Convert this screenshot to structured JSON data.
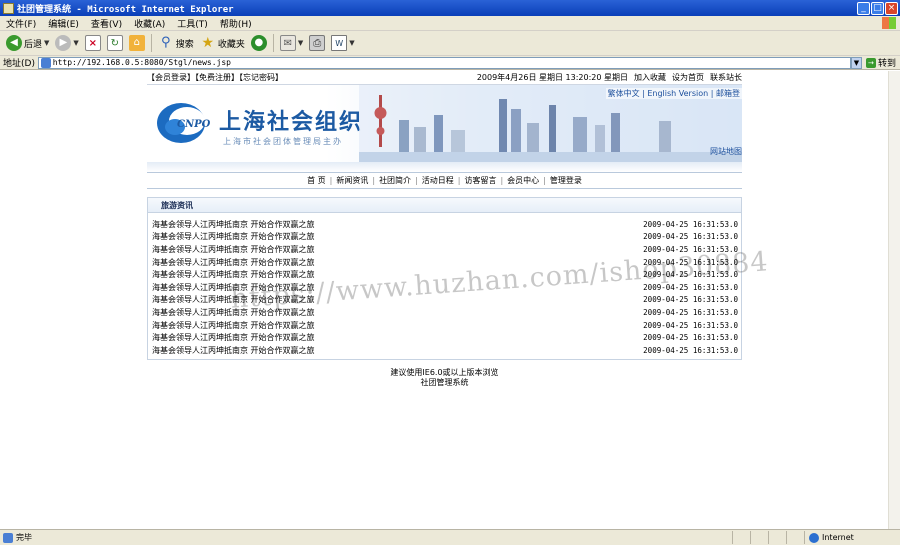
{
  "window": {
    "title": "社团管理系统 - Microsoft Internet Explorer",
    "minimize": "_",
    "maximize": "□",
    "close": "×"
  },
  "menubar": {
    "items": [
      "文件(F)",
      "编辑(E)",
      "查看(V)",
      "收藏(A)",
      "工具(T)",
      "帮助(H)"
    ]
  },
  "toolbar": {
    "back": "后退",
    "search": "搜索",
    "favorites": "收藏夹"
  },
  "address": {
    "label": "地址(D)",
    "url": "http://192.168.0.5:8080/Stgl/news.jsp",
    "go": "转到"
  },
  "page": {
    "top_links": "【会员登录】【免费注册】【忘记密码】",
    "date_text": "2009年4月26日 星期日 13:20:20 星期日",
    "top_right": [
      "加入收藏",
      "设为首页",
      "联系站长"
    ],
    "site_name": "上海社会组织",
    "site_sub": "上海市社会团体管理局主办",
    "logo_text": "CNPO",
    "lang_links": "繁体中文 | English Version | 邮箱登",
    "sitemap": "网站地图",
    "nav": [
      "首 页",
      "新闻资讯",
      "社团简介",
      "活动日程",
      "访客留言",
      "会员中心",
      "管理登录"
    ],
    "section_title": "旅游资讯",
    "news": [
      {
        "title": "海基会领导人江丙坤抵南京 开始合作双赢之旅",
        "date": "2009-04-25 16:31:53.0"
      },
      {
        "title": "海基会领导人江丙坤抵南京 开始合作双赢之旅",
        "date": "2009-04-25 16:31:53.0"
      },
      {
        "title": "海基会领导人江丙坤抵南京 开始合作双赢之旅",
        "date": "2009-04-25 16:31:53.0"
      },
      {
        "title": "海基会领导人江丙坤抵南京 开始合作双赢之旅",
        "date": "2009-04-25 16:31:53.0"
      },
      {
        "title": "海基会领导人江丙坤抵南京 开始合作双赢之旅",
        "date": "2009-04-25 16:31:53.0"
      },
      {
        "title": "海基会领导人江丙坤抵南京 开始合作双赢之旅",
        "date": "2009-04-25 16:31:53.0"
      },
      {
        "title": "海基会领导人江丙坤抵南京 开始合作双赢之旅",
        "date": "2009-04-25 16:31:53.0"
      },
      {
        "title": "海基会领导人江丙坤抵南京 开始合作双赢之旅",
        "date": "2009-04-25 16:31:53.0"
      },
      {
        "title": "海基会领导人江丙坤抵南京 开始合作双赢之旅",
        "date": "2009-04-25 16:31:53.0"
      },
      {
        "title": "海基会领导人江丙坤抵南京 开始合作双赢之旅",
        "date": "2009-04-25 16:31:53.0"
      },
      {
        "title": "海基会领导人江丙坤抵南京 开始合作双赢之旅",
        "date": "2009-04-25 16:31:53.0"
      }
    ],
    "footer_line1": "建议使用IE6.0或以上版本浏览",
    "footer_line2": "社团管理系统"
  },
  "watermark": "https://www.huzhan.com/ishop30884",
  "statusbar": {
    "status": "完毕",
    "zone": "Internet"
  }
}
